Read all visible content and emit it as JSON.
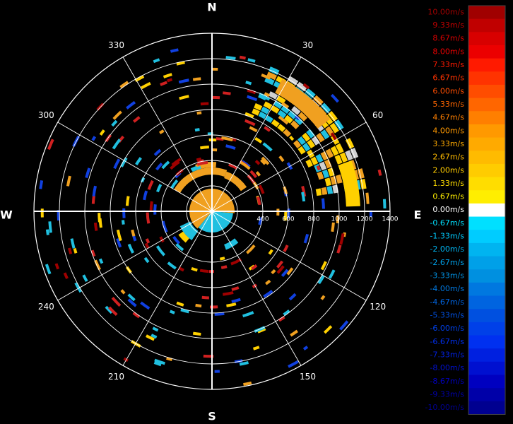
{
  "chart_data": {
    "type": "polar-radar",
    "compass": {
      "north": "N",
      "east": "E",
      "south": "S",
      "west": "W"
    },
    "bearing_labels": [
      "30",
      "60",
      "120",
      "150",
      "210",
      "240",
      "300",
      "330"
    ],
    "range_labels": [
      "400",
      "600",
      "800",
      "1000",
      "1200",
      "1400"
    ],
    "colorbar": {
      "labels": [
        "10.00m/s",
        "9.33m/s",
        "8.67m/s",
        "8.00m/s",
        "7.33m/s",
        "6.67m/s",
        "6.00m/s",
        "5.33m/s",
        "4.67m/s",
        "4.00m/s",
        "3.33m/s",
        "2.67m/s",
        "2.00m/s",
        "1.33m/s",
        "0.67m/s",
        "0.00m/s",
        "-0.67m/s",
        "-1.33m/s",
        "-2.00m/s",
        "-2.67m/s",
        "-3.33m/s",
        "-4.00m/s",
        "-4.67m/s",
        "-5.33m/s",
        "-6.00m/s",
        "-6.67m/s",
        "-7.33m/s",
        "-8.00m/s",
        "-8.67m/s",
        "-9.33m/s",
        "-10.00m/s"
      ],
      "colors": [
        "#a00000",
        "#c00000",
        "#d80000",
        "#ec0000",
        "#ff1a00",
        "#ff3300",
        "#ff4d00",
        "#ff6600",
        "#ff7f00",
        "#ff9900",
        "#ffaa00",
        "#ffbb00",
        "#ffcc00",
        "#ffdd00",
        "#ffee00",
        "#ffffff",
        "#00e0ff",
        "#00ccff",
        "#00b4f0",
        "#00a0e8",
        "#0090e0",
        "#0078e0",
        "#0064e0",
        "#0050e0",
        "#0040e8",
        "#0030f0",
        "#0020e0",
        "#0010d0",
        "#0000c0",
        "#0000a8",
        "#000090"
      ]
    },
    "echo_colors": {
      "orange": "#f0a020",
      "yellow": "#ffd000",
      "cyan": "#20c0e0",
      "grey": "#d0d0d0",
      "red": "#d02020",
      "darkred": "#a00000",
      "blue": "#1040e0"
    }
  }
}
